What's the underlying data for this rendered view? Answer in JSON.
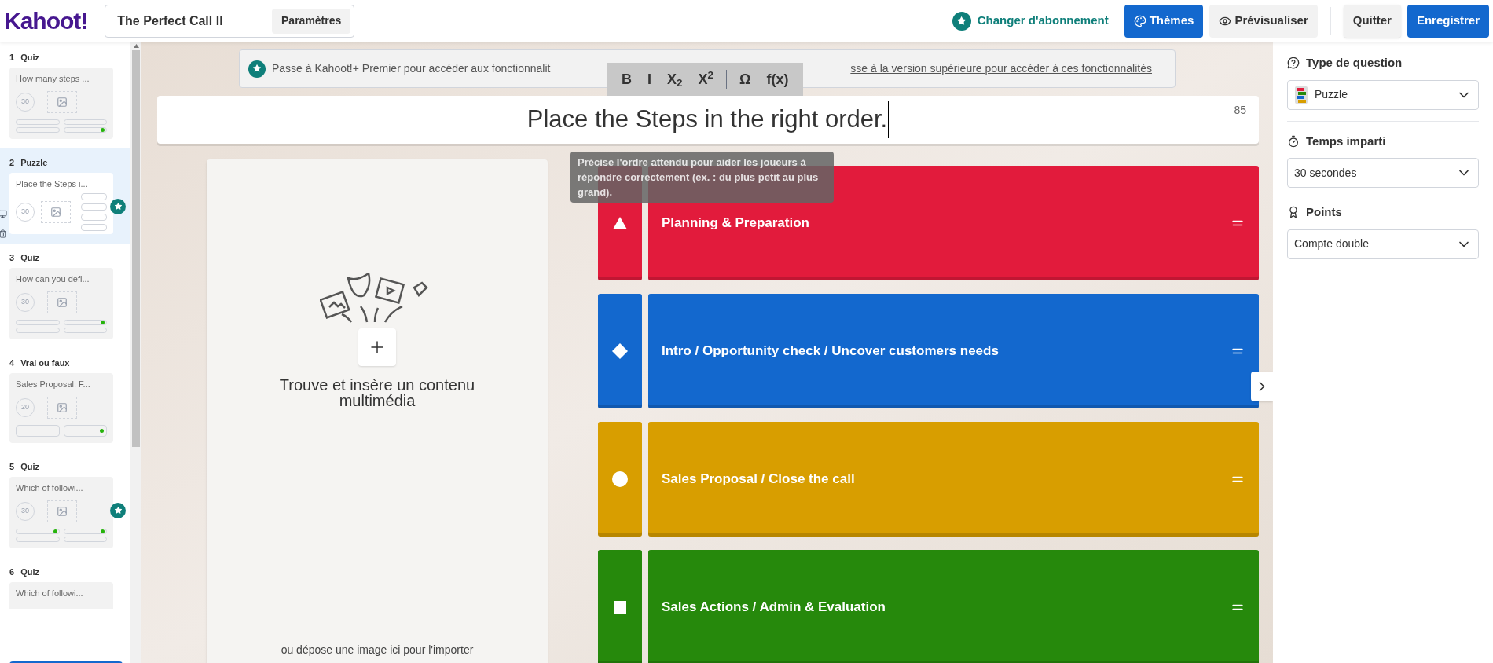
{
  "header": {
    "logo": "Kahoot!",
    "title": "The Perfect Call II",
    "settings_button": "Paramètres",
    "upgrade_link": "Changer d'abonnement",
    "buttons": [
      {
        "kind": "themes",
        "label": "Thèmes"
      },
      {
        "kind": "preview",
        "label": "Prévisualiser"
      },
      {
        "kind": "quit",
        "label": "Quitter"
      },
      {
        "kind": "save",
        "label": "Enregistrer"
      }
    ]
  },
  "sidebar": {
    "slides": [
      {
        "number": "1",
        "type": "Quiz",
        "title": "How many steps ...",
        "time": "30",
        "kind": "quiz",
        "selected": false,
        "premium": false,
        "answers": [
          {
            "correct": false
          },
          {
            "correct": false
          },
          {
            "correct": false
          },
          {
            "correct": true
          }
        ]
      },
      {
        "number": "2",
        "type": "Puzzle",
        "title": "Place the Steps i...",
        "time": "30",
        "kind": "puzzle",
        "selected": true,
        "premium": true,
        "answers": [
          {
            "correct": false
          },
          {
            "correct": false
          },
          {
            "correct": false
          },
          {
            "correct": false
          }
        ]
      },
      {
        "number": "3",
        "type": "Quiz",
        "title": "How can you defi...",
        "time": "30",
        "kind": "quiz",
        "selected": false,
        "premium": false,
        "answers": [
          {
            "correct": false
          },
          {
            "correct": true
          },
          {
            "correct": false
          },
          {
            "correct": false
          }
        ]
      },
      {
        "number": "4",
        "type": "Vrai ou faux",
        "title": "Sales Proposal: F...",
        "time": "20",
        "kind": "truefalse",
        "selected": false,
        "premium": false,
        "answers": [
          {
            "correct": false
          },
          {
            "correct": true
          }
        ]
      },
      {
        "number": "5",
        "type": "Quiz",
        "title": "Which of followi...",
        "time": "30",
        "kind": "quiz",
        "selected": false,
        "premium": true,
        "answers": [
          {
            "correct": true
          },
          {
            "correct": true
          },
          {
            "correct": false
          },
          {
            "correct": false
          }
        ]
      },
      {
        "number": "6",
        "type": "Quiz",
        "title": "Which of followi...",
        "kind": "partial",
        "selected": false,
        "premium": false
      }
    ]
  },
  "banner": {
    "text": "Passe à Kahoot!+ Premier pour accéder aux fonctionnalit",
    "link": "sse à la version supérieure pour accéder à ces fonctionnalités"
  },
  "toolbar": [
    "B",
    "I",
    "X$_{2}$",
    "X$^{2}$",
    "Ω",
    "f(x)"
  ],
  "question": {
    "value": "Place the Steps in the right order.",
    "count": "85"
  },
  "tooltip": "Précise l'ordre attendu pour aider les joueurs à répondre correctement (ex. : du plus petit au plus grand).",
  "media": {
    "title": "Trouve et insère un contenu multimédia",
    "hint": "ou dépose une image ici pour l'importer"
  },
  "answers": [
    {
      "kind": "triangle",
      "color": "#e21b3c",
      "text": "Planning & Preparation"
    },
    {
      "kind": "diamond",
      "color": "#1368ce",
      "text": "Intro / Opportunity check / Uncover customers needs"
    },
    {
      "kind": "circle",
      "color": "#d89e00",
      "text": "Sales Proposal / Close the call"
    },
    {
      "kind": "square",
      "color": "#26890c",
      "text": "Sales Actions / Admin & Evaluation"
    }
  ],
  "settings": {
    "sections": [
      {
        "kind": "type",
        "label": "Type de question",
        "value": "Puzzle"
      },
      {
        "kind": "time",
        "label": "Temps imparti",
        "value": "30 secondes"
      },
      {
        "kind": "points",
        "label": "Points",
        "value": "Compte double"
      }
    ]
  }
}
